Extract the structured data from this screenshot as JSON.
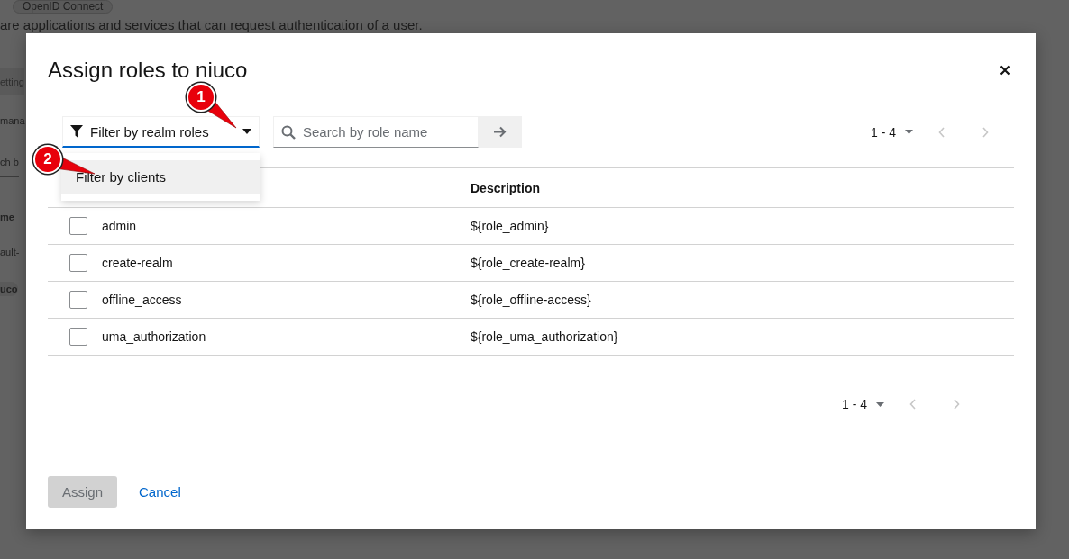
{
  "background": {
    "badge": "OpenID Connect",
    "description": "are applications and services that can request authentication of a user.",
    "fragments": [
      {
        "kind": "tab",
        "text": "etting"
      },
      {
        "kind": "label",
        "text": "mana"
      },
      {
        "kind": "field",
        "text": "ch b"
      },
      {
        "kind": "header",
        "text": "me"
      },
      {
        "kind": "cell",
        "text": "ault-"
      },
      {
        "kind": "chip",
        "text": "uco"
      }
    ]
  },
  "modal": {
    "title": "Assign roles to niuco",
    "filter": {
      "label": "Filter by realm roles",
      "expanded": true,
      "options": [
        {
          "label": "Filter by clients",
          "selected": false
        }
      ]
    },
    "search": {
      "placeholder": "Search by role name"
    },
    "pagination_top": {
      "range": "1 - 4",
      "prev_disabled": true,
      "next_disabled": true
    },
    "table": {
      "description_header": "Description",
      "rows": [
        {
          "name": "admin",
          "description": "${role_admin}",
          "checked": false
        },
        {
          "name": "create-realm",
          "description": "${role_create-realm}",
          "checked": false
        },
        {
          "name": "offline_access",
          "description": "${role_offline-access}",
          "checked": false
        },
        {
          "name": "uma_authorization",
          "description": "${role_uma_authorization}",
          "checked": false
        }
      ]
    },
    "pagination_bottom": {
      "range": "1 - 4",
      "prev_disabled": true,
      "next_disabled": true
    },
    "assign_button": {
      "label": "Assign",
      "disabled": true
    },
    "cancel_link": {
      "label": "Cancel"
    }
  },
  "annotations": [
    {
      "label": "1"
    },
    {
      "label": "2"
    }
  ]
}
